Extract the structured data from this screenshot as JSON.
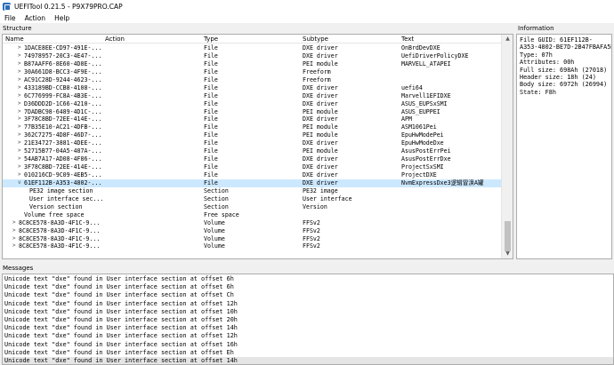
{
  "window": {
    "title": "UEFITool 0.21.5 - P9X79PRO.CAP"
  },
  "menu": [
    "File",
    "Action",
    "Help"
  ],
  "structure": {
    "label": "Structure",
    "columns": [
      "Name",
      "Action",
      "Type",
      "Subtype",
      "Text"
    ],
    "rows": [
      {
        "chev": ">",
        "name": "1DACE8EE-CD97-491E-...",
        "action": "",
        "type": "File",
        "subtype": "DXE driver",
        "text": "OnBrdDevDXE",
        "indent": 1
      },
      {
        "chev": ">",
        "name": "74978957-20C3-4E47-...",
        "action": "",
        "type": "File",
        "subtype": "DXE driver",
        "text": "UefiDriverPolicyDXE",
        "indent": 1
      },
      {
        "chev": ">",
        "name": "B87AAFF6-8E60-4D8E-...",
        "action": "",
        "type": "File",
        "subtype": "PEI module",
        "text": "MARVELL_ATAPEI",
        "indent": 1
      },
      {
        "chev": ">",
        "name": "30A661D8-BCC3-4F9E-...",
        "action": "",
        "type": "File",
        "subtype": "Freeform",
        "text": "",
        "indent": 1
      },
      {
        "chev": ">",
        "name": "AC91C28D-9244-4623-...",
        "action": "",
        "type": "File",
        "subtype": "Freeform",
        "text": "",
        "indent": 1
      },
      {
        "chev": ">",
        "name": "433189BD-CCB8-4108-...",
        "action": "",
        "type": "File",
        "subtype": "DXE driver",
        "text": "uefi64",
        "indent": 1
      },
      {
        "chev": ">",
        "name": "6C776999-FC8A-4B3E-...",
        "action": "",
        "type": "File",
        "subtype": "DXE driver",
        "text": "Marvell1EFIDXE",
        "indent": 1
      },
      {
        "chev": ">",
        "name": "D36DDD2D-1C66-4210-...",
        "action": "",
        "type": "File",
        "subtype": "DXE driver",
        "text": "ASUS_EUPSxSMI",
        "indent": 1
      },
      {
        "chev": ">",
        "name": "7DADBC98-6489-4D1C-...",
        "action": "",
        "type": "File",
        "subtype": "PEI module",
        "text": "ASUS_EUPPEI",
        "indent": 1
      },
      {
        "chev": ">",
        "name": "3F78C8BD-72EE-414E-...",
        "action": "",
        "type": "File",
        "subtype": "DXE driver",
        "text": "APM",
        "indent": 1
      },
      {
        "chev": ">",
        "name": "77B35E10-AC21-4DFB-...",
        "action": "",
        "type": "File",
        "subtype": "PEI module",
        "text": "ASM1061Pei",
        "indent": 1
      },
      {
        "chev": ">",
        "name": "362C7275-4D8F-46D7-...",
        "action": "",
        "type": "File",
        "subtype": "PEI module",
        "text": "EpuHwModePei",
        "indent": 1
      },
      {
        "chev": ">",
        "name": "21E34727-3881-4DEE-...",
        "action": "",
        "type": "File",
        "subtype": "DXE driver",
        "text": "EpuHwModeDxe",
        "indent": 1
      },
      {
        "chev": ">",
        "name": "52715B77-04A5-487A-...",
        "action": "",
        "type": "File",
        "subtype": "PEI module",
        "text": "AsusPostErrPei",
        "indent": 1
      },
      {
        "chev": ">",
        "name": "54AB7A17-AD08-4F86-...",
        "action": "",
        "type": "File",
        "subtype": "DXE driver",
        "text": "AsusPostErrDxe",
        "indent": 1
      },
      {
        "chev": ">",
        "name": "3F78C8BD-72EE-414E-...",
        "action": "",
        "type": "File",
        "subtype": "DXE driver",
        "text": "ProjectSxSMI",
        "indent": 1
      },
      {
        "chev": ">",
        "name": "010216CD-9C09-4EB5-...",
        "action": "",
        "type": "File",
        "subtype": "DXE driver",
        "text": "ProjectDXE",
        "indent": 1
      },
      {
        "chev": "v",
        "name": "61EF112B-A353-4802-...",
        "action": "",
        "type": "File",
        "subtype": "DXE driver",
        "text": "NvmExpressDxe3逻辑冒涣A罐",
        "indent": 1,
        "selected": true
      },
      {
        "chev": "",
        "name": "PE32 image section",
        "action": "",
        "type": "Section",
        "subtype": "PE32 image",
        "text": "",
        "indent": 2
      },
      {
        "chev": "",
        "name": "User interface sec...",
        "action": "",
        "type": "Section",
        "subtype": "User interface",
        "text": "",
        "indent": 2
      },
      {
        "chev": "",
        "name": "Version section",
        "action": "",
        "type": "Section",
        "subtype": "Version",
        "text": "",
        "indent": 2
      },
      {
        "chev": "",
        "name": "Volume free space",
        "action": "",
        "type": "Free space",
        "subtype": "",
        "text": "",
        "indent": 1
      },
      {
        "chev": ">",
        "name": "8C8CE578-8A3D-4F1C-9...",
        "action": "",
        "type": "Volume",
        "subtype": "FFSv2",
        "text": "",
        "indent": 0
      },
      {
        "chev": ">",
        "name": "8C8CE578-8A3D-4F1C-9...",
        "action": "",
        "type": "Volume",
        "subtype": "FFSv2",
        "text": "",
        "indent": 0
      },
      {
        "chev": ">",
        "name": "8C8CE578-8A3D-4F1C-9...",
        "action": "",
        "type": "Volume",
        "subtype": "FFSv2",
        "text": "",
        "indent": 0
      },
      {
        "chev": ">",
        "name": "8C8CE578-8A3D-4F1C-9...",
        "action": "",
        "type": "Volume",
        "subtype": "FFSv2",
        "text": "",
        "indent": 0
      }
    ]
  },
  "information": {
    "label": "Information",
    "lines": [
      "File GUID: 61EF112B-",
      "A353-4802-BE7D-2B47FBAFA5B5",
      "Type: 07h",
      "Attributes: 00h",
      "Full size: 698Ah (27018)",
      "Header size: 18h (24)",
      "Body size: 6972h (26994)",
      "State: F8h"
    ]
  },
  "messages": {
    "label": "Messages",
    "lines": [
      "Unicode text \"dxe\" found in User interface section at offset 6h",
      "Unicode text \"dxe\" found in User interface section at offset 6h",
      "Unicode text \"dxe\" found in User interface section at offset Ch",
      "Unicode text \"dxe\" found in User interface section at offset 12h",
      "Unicode text \"dxe\" found in User interface section at offset 10h",
      "Unicode text \"dxe\" found in User interface section at offset 20h",
      "Unicode text \"dxe\" found in User interface section at offset 14h",
      "Unicode text \"dxe\" found in User interface section at offset 12h",
      "Unicode text \"dxe\" found in User interface section at offset 16h",
      "Unicode text \"dxe\" found in User interface section at offset Eh",
      "Unicode text \"dxe\" found in User interface section at offset 14h"
    ]
  }
}
